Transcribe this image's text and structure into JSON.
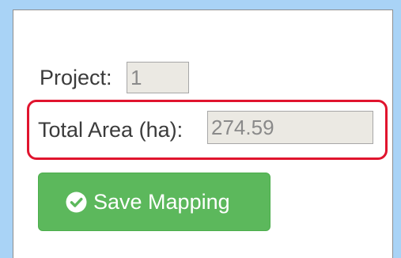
{
  "form": {
    "project_label": "Project:",
    "project_value": "1",
    "area_label": "Total Area (ha):",
    "area_value": "274.59"
  },
  "actions": {
    "save_label": "Save Mapping",
    "save_icon": "check-circle-icon"
  },
  "colors": {
    "frame_border": "#a9d3f6",
    "highlight": "#e0142e",
    "button": "#5cb85c",
    "readonly_field": "#ebe9e3"
  }
}
